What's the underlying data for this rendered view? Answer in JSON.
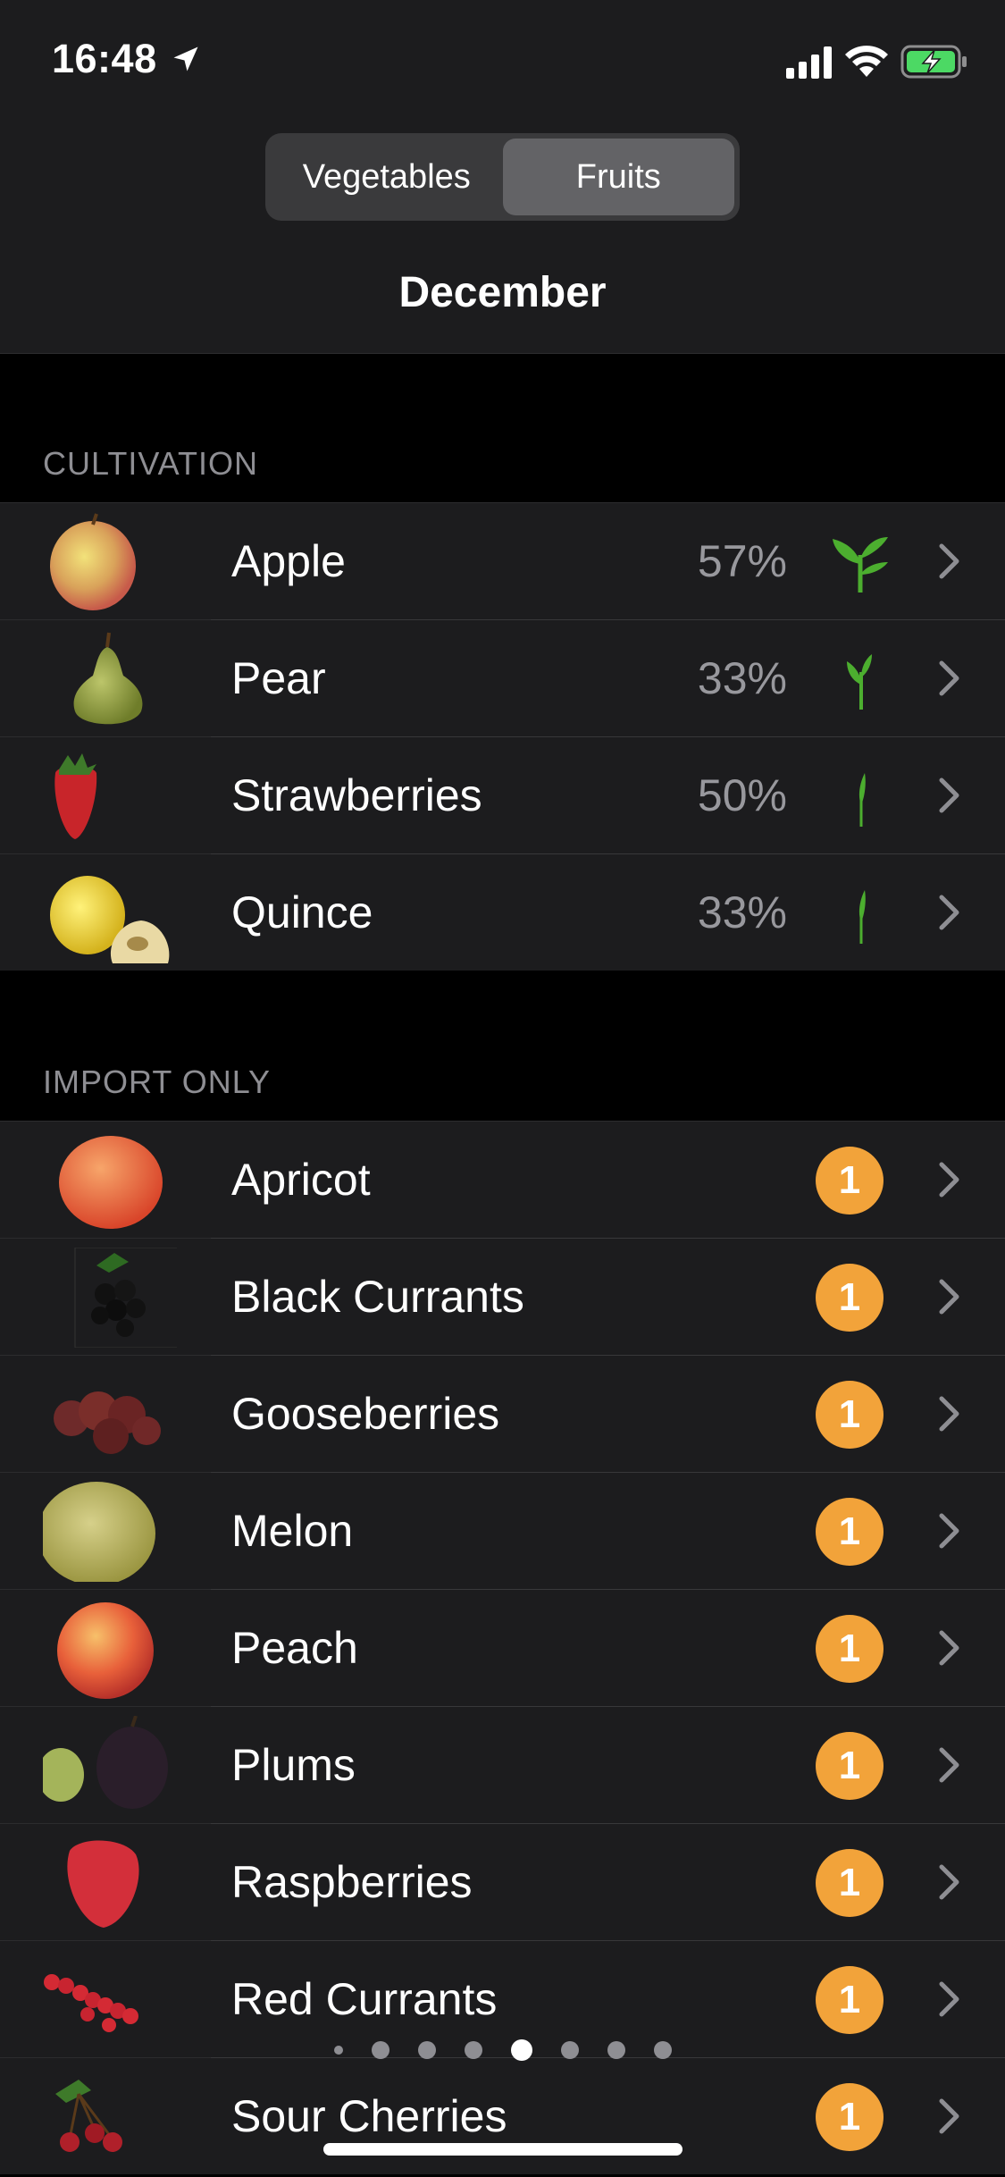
{
  "status_bar": {
    "time": "16:48"
  },
  "segmented_control": {
    "items": [
      "Vegetables",
      "Fruits"
    ],
    "selected": "Fruits"
  },
  "month": "December",
  "sections": {
    "cultivation": {
      "header": "CULTIVATION",
      "items": [
        {
          "name": "Apple",
          "percent": "57%",
          "icon": "seedling-icon"
        },
        {
          "name": "Pear",
          "percent": "33%",
          "icon": "sprout-icon"
        },
        {
          "name": "Strawberries",
          "percent": "50%",
          "icon": "shoot-icon"
        },
        {
          "name": "Quince",
          "percent": "33%",
          "icon": "shoot-icon"
        }
      ]
    },
    "import_only": {
      "header": "IMPORT ONLY",
      "items": [
        {
          "name": "Apricot",
          "badge": "1"
        },
        {
          "name": "Black Currants",
          "badge": "1"
        },
        {
          "name": "Gooseberries",
          "badge": "1"
        },
        {
          "name": "Melon",
          "badge": "1"
        },
        {
          "name": "Peach",
          "badge": "1"
        },
        {
          "name": "Plums",
          "badge": "1"
        },
        {
          "name": "Raspberries",
          "badge": "1"
        },
        {
          "name": "Red Currants",
          "badge": "1"
        },
        {
          "name": "Sour Cherries",
          "badge": "1"
        }
      ]
    }
  },
  "page_indicator": {
    "count": 8,
    "current": 5
  },
  "colors": {
    "badge": "#f2a33a",
    "plant": "#4cae2f",
    "background": "#000000",
    "row": "#1c1c1e"
  }
}
